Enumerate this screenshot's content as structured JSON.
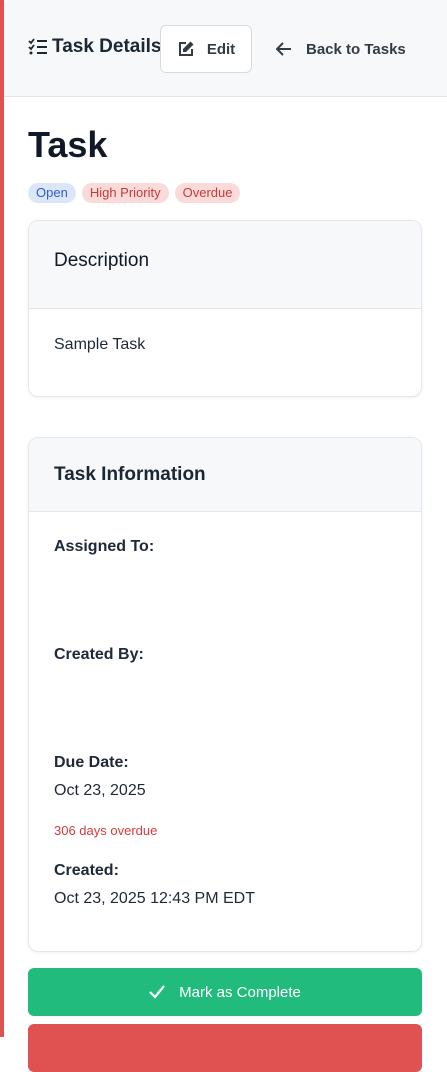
{
  "header": {
    "title": "Task Details",
    "title_icon": "list-check-icon",
    "edit_label": "Edit",
    "edit_icon": "pencil-square-icon",
    "back_label": "Back to Tasks",
    "back_icon": "arrow-left-icon"
  },
  "task": {
    "title": "Task",
    "badges": [
      "Open",
      "High Priority",
      "Overdue"
    ]
  },
  "description": {
    "heading": "Description",
    "text": "Sample Task"
  },
  "info": {
    "heading": "Task Information",
    "assigned_label": "Assigned To:",
    "assigned_value": "",
    "created_by_label": "Created By:",
    "created_by_value": "",
    "due_label": "Due Date:",
    "due_value": "Oct 23, 2025",
    "overdue_note": "306 days overdue",
    "created_label": "Created:",
    "created_value": "Oct 23, 2025 12:43 PM EDT"
  },
  "actions": {
    "complete_label": "Mark as Complete",
    "complete_icon": "check-icon"
  },
  "colors": {
    "accent": "#e05252",
    "success": "#22bb7e",
    "danger_text": "#d63b3b",
    "badge_open_bg": "#dbe6fb",
    "badge_alert_bg": "#fbdada"
  }
}
